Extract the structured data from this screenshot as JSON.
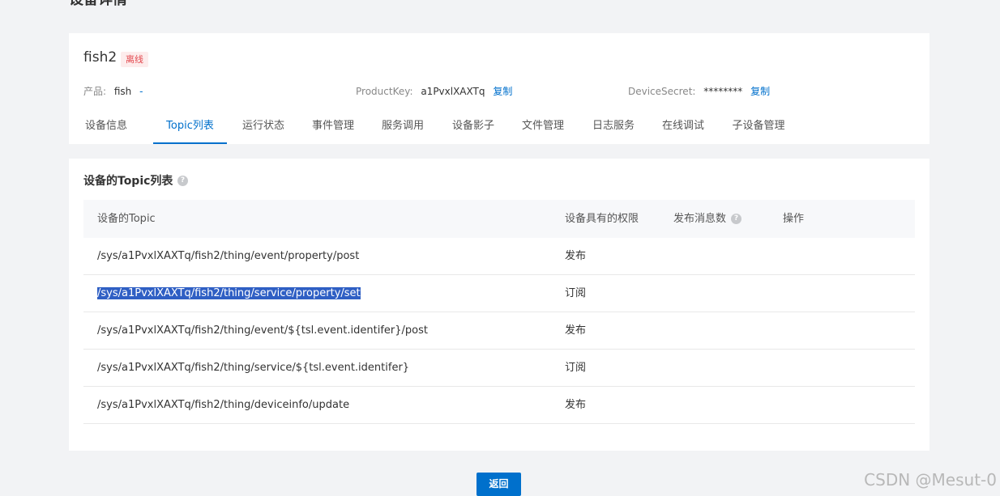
{
  "page": {
    "title": "设备详情"
  },
  "device": {
    "name": "fish2",
    "status": "离线",
    "product_label": "产品:",
    "product_value": "fish",
    "product_link": "-",
    "productkey_label": "ProductKey:",
    "productkey_value": "a1PvxlXAXTq",
    "productkey_copy": "复制",
    "devicesecret_label": "DeviceSecret:",
    "devicesecret_value": "********",
    "devicesecret_copy": "复制"
  },
  "tabs": [
    {
      "label": "设备信息"
    },
    {
      "label": "Topic列表",
      "active": true
    },
    {
      "label": "运行状态"
    },
    {
      "label": "事件管理"
    },
    {
      "label": "服务调用"
    },
    {
      "label": "设备影子"
    },
    {
      "label": "文件管理"
    },
    {
      "label": "日志服务"
    },
    {
      "label": "在线调试"
    },
    {
      "label": "子设备管理"
    }
  ],
  "topic_section": {
    "title": "设备的Topic列表",
    "help_icon": "question-circle-icon",
    "columns": {
      "topic": "设备的Topic",
      "permission": "设备具有的权限",
      "message_count": "发布消息数",
      "operation": "操作"
    },
    "rows": [
      {
        "topic": "/sys/a1PvxlXAXTq/fish2/thing/event/property/post",
        "permission": "发布"
      },
      {
        "topic": "/sys/a1PvxlXAXTq/fish2/thing/service/property/set",
        "permission": "订阅"
      },
      {
        "topic": "/sys/a1PvxlXAXTq/fish2/thing/event/${tsl.event.identifer}/post",
        "permission": "发布"
      },
      {
        "topic": "/sys/a1PvxlXAXTq/fish2/thing/service/${tsl.event.identifer}",
        "permission": "订阅"
      },
      {
        "topic": "/sys/a1PvxlXAXTq/fish2/thing/deviceinfo/update",
        "permission": "发布"
      }
    ]
  },
  "footer": {
    "back_label": "返回"
  },
  "watermark": "CSDN @Mesut-0",
  "colors": {
    "accent": "#0070cc",
    "offline": "#e3494f",
    "selection": "#2f5fc4"
  }
}
